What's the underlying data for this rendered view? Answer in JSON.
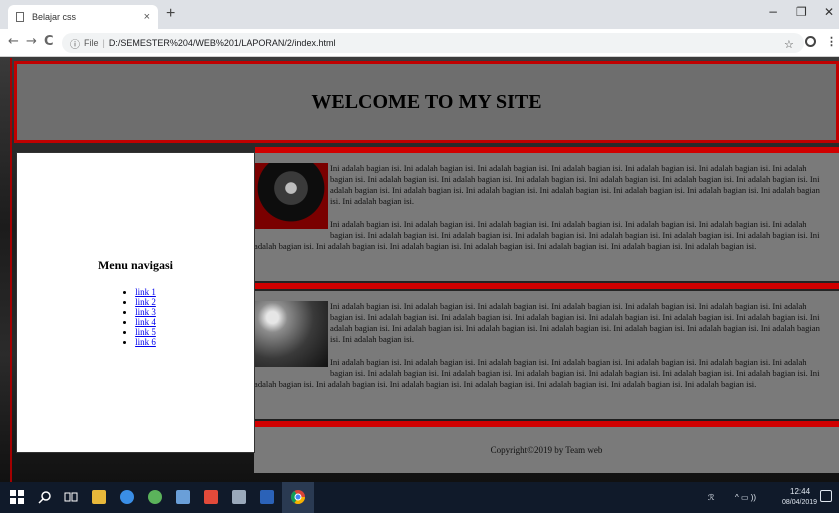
{
  "browser": {
    "tab_title": "Belajar css",
    "tab_close": "×",
    "new_tab": "+",
    "minimize": "−",
    "restore": "❐",
    "close": "✕",
    "back": "←",
    "forward": "→",
    "reload": "C",
    "info": "ⓘ",
    "scheme": "File",
    "separator": "|",
    "url": "D:/SEMESTER%204/WEB%201/LAPORAN/2/index.html",
    "star": "☆",
    "menu": "⋮"
  },
  "page": {
    "header_title": "WELCOME TO MY SITE",
    "sidebar": {
      "heading": "Menu navigasi",
      "links": [
        "link 1",
        "link 2",
        "link 3",
        "link 4",
        "link 5",
        "link 6"
      ]
    },
    "content": [
      {
        "para1": "Ini adalah bagian isi. Ini adalah bagian isi. Ini adalah bagian isi. Ini adalah bagian isi. Ini adalah bagian isi. Ini adalah bagian isi. Ini adalah bagian isi. Ini adalah bagian isi. Ini adalah bagian isi. Ini adalah bagian isi. Ini adalah bagian isi. Ini adalah bagian isi. Ini adalah bagian isi. Ini adalah bagian isi. Ini adalah bagian isi. Ini adalah bagian isi. Ini adalah bagian isi. Ini adalah bagian isi. Ini adalah bagian isi. Ini adalah bagian isi. Ini adalah bagian isi.",
        "para2": "Ini adalah bagian isi. Ini adalah bagian isi. Ini adalah bagian isi. Ini adalah bagian isi. Ini adalah bagian isi. Ini adalah bagian isi. Ini adalah bagian isi. Ini adalah bagian isi. Ini adalah bagian isi. Ini adalah bagian isi. Ini adalah bagian isi. Ini adalah bagian isi. Ini adalah bagian isi. Ini adalah bagian isi. Ini adalah bagian isi. Ini adalah bagian isi. Ini adalah bagian isi. Ini adalah bagian isi. Ini adalah bagian isi. Ini adalah bagian isi."
      },
      {
        "para1": "Ini adalah bagian isi. Ini adalah bagian isi. Ini adalah bagian isi. Ini adalah bagian isi. Ini adalah bagian isi. Ini adalah bagian isi. Ini adalah bagian isi. Ini adalah bagian isi. Ini adalah bagian isi. Ini adalah bagian isi. Ini adalah bagian isi. Ini adalah bagian isi. Ini adalah bagian isi. Ini adalah bagian isi. Ini adalah bagian isi. Ini adalah bagian isi. Ini adalah bagian isi. Ini adalah bagian isi. Ini adalah bagian isi. Ini adalah bagian isi. Ini adalah bagian isi.",
        "para2": "Ini adalah bagian isi. Ini adalah bagian isi. Ini adalah bagian isi. Ini adalah bagian isi. Ini adalah bagian isi. Ini adalah bagian isi. Ini adalah bagian isi. Ini adalah bagian isi. Ini adalah bagian isi. Ini adalah bagian isi. Ini adalah bagian isi. Ini adalah bagian isi. Ini adalah bagian isi. Ini adalah bagian isi. Ini adalah bagian isi. Ini adalah bagian isi. Ini adalah bagian isi. Ini adalah bagian isi. Ini adalah bagian isi. Ini adalah bagian isi."
      }
    ],
    "footer": "Copyright©2019 by Team web"
  },
  "taskbar": {
    "time": "12:44",
    "date": "08/04/2019",
    "tray": "^ ▭ ))"
  },
  "colors": {
    "accent_red": "#c00000",
    "header_gray": "#6e6e6e",
    "content_gray": "#7a7a7a",
    "link_blue": "#0000ee",
    "taskbar": "#101a2a"
  }
}
